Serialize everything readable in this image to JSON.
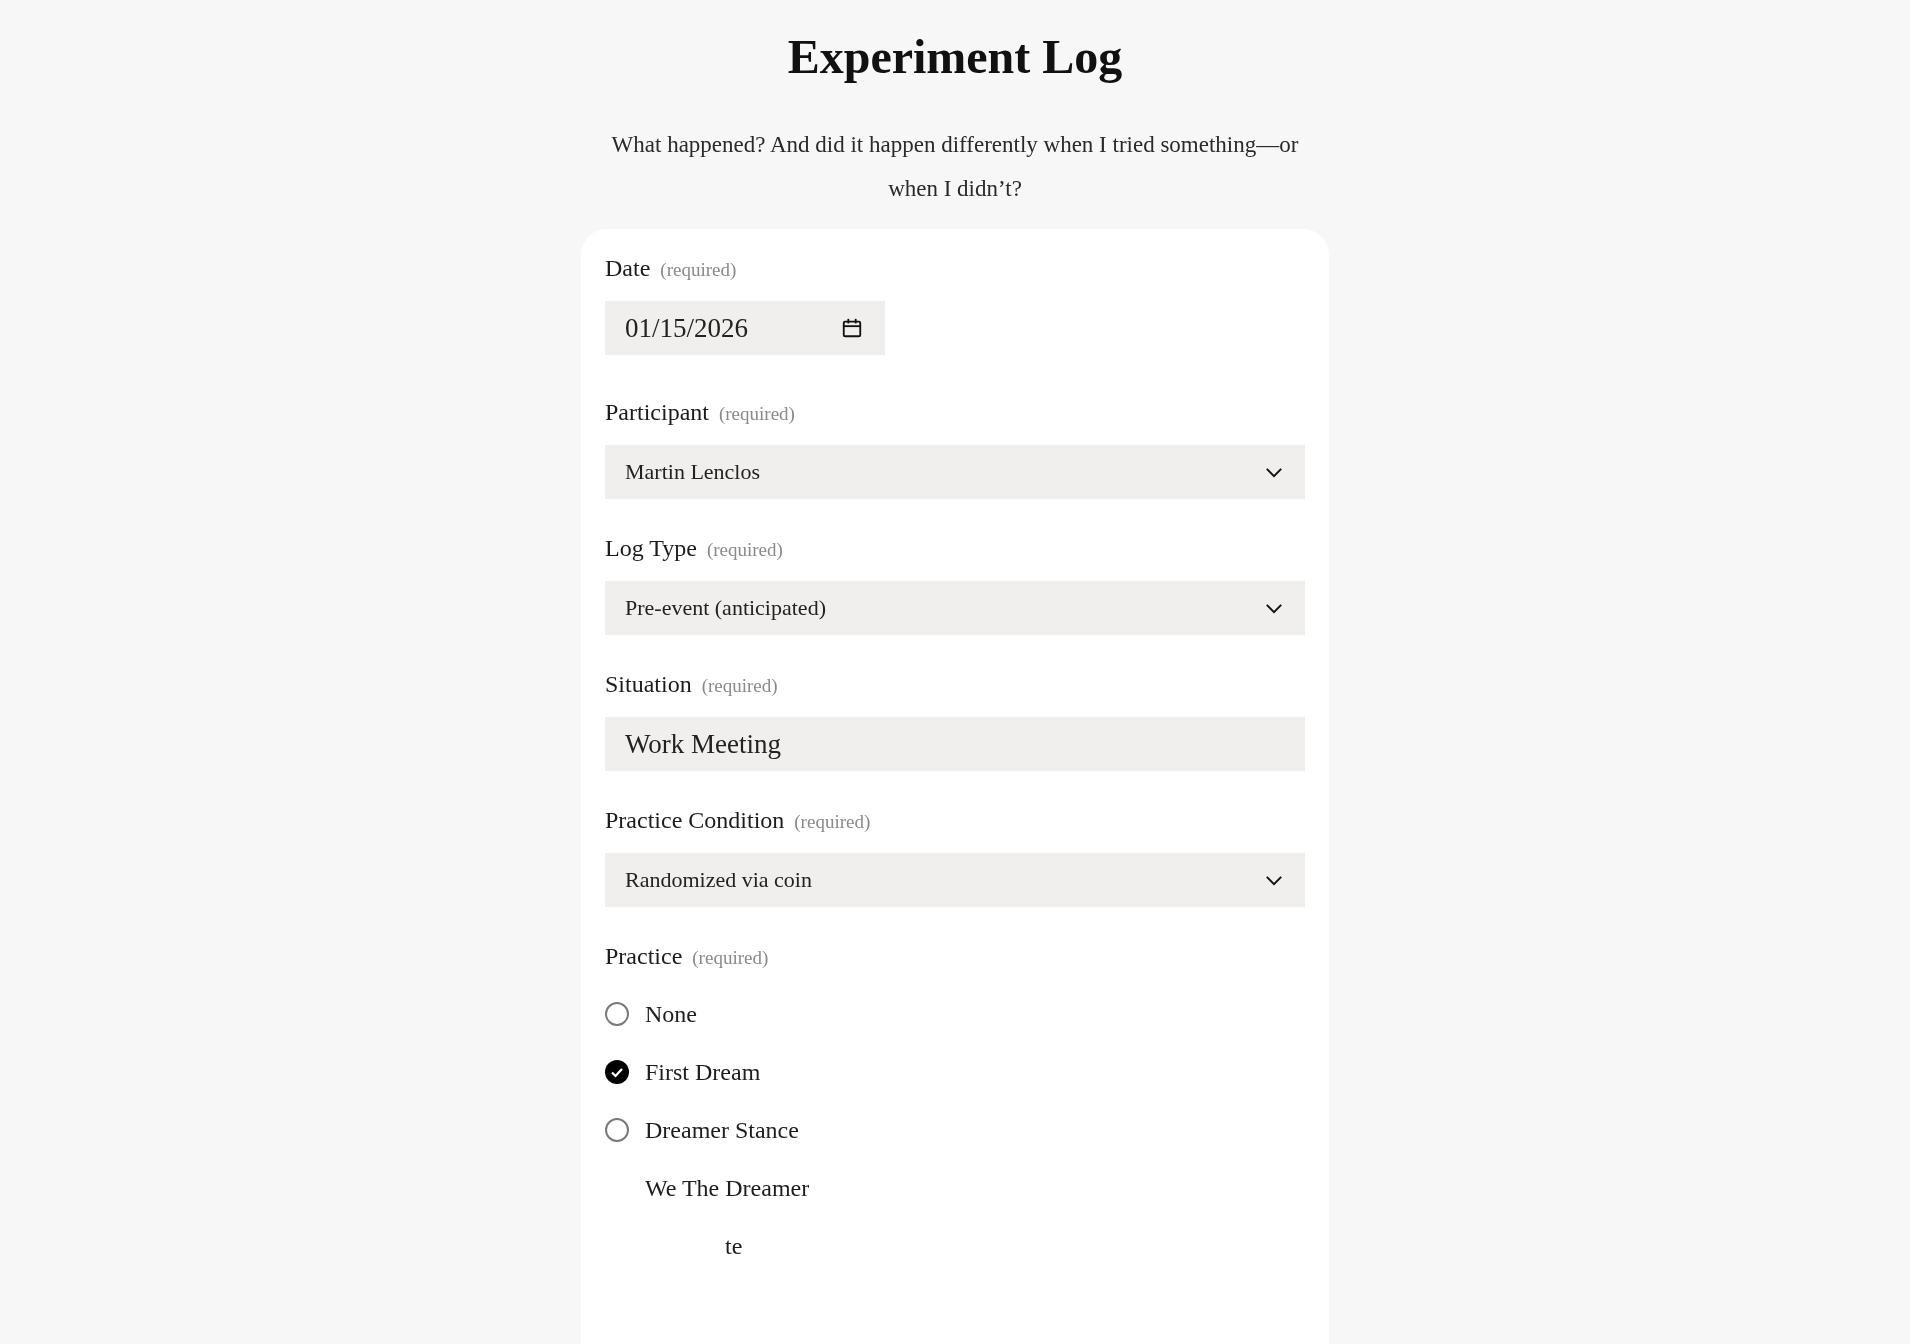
{
  "header": {
    "title": "Experiment Log",
    "subtitle": "What happened? And did it happen differently when I tried something—or when I didn’t?"
  },
  "form": {
    "fields": [
      {
        "kind": "date",
        "label": "Date",
        "note": "(required)",
        "value": "01/15/2026"
      },
      {
        "kind": "select",
        "label": "Participant",
        "note": "(required)",
        "value": "Martin Lenclos"
      },
      {
        "kind": "select",
        "label": "Log Type",
        "note": "(required)",
        "value": "Pre-event (anticipated)"
      },
      {
        "kind": "text",
        "label": "Situation",
        "note": "(required)",
        "value": "Work Meeting"
      },
      {
        "kind": "select",
        "label": "Practice Condition",
        "note": "(required)",
        "value": "Randomized via coin"
      }
    ],
    "radio_group": {
      "label": "Practice",
      "note": "(required)",
      "options": [
        {
          "label": "None",
          "selected": false
        },
        {
          "label": "First Dream",
          "selected": true
        },
        {
          "label": "Dreamer Stance",
          "selected": false
        },
        {
          "label": "We The Dreamer"
        },
        {
          "label": "te"
        }
      ]
    }
  }
}
